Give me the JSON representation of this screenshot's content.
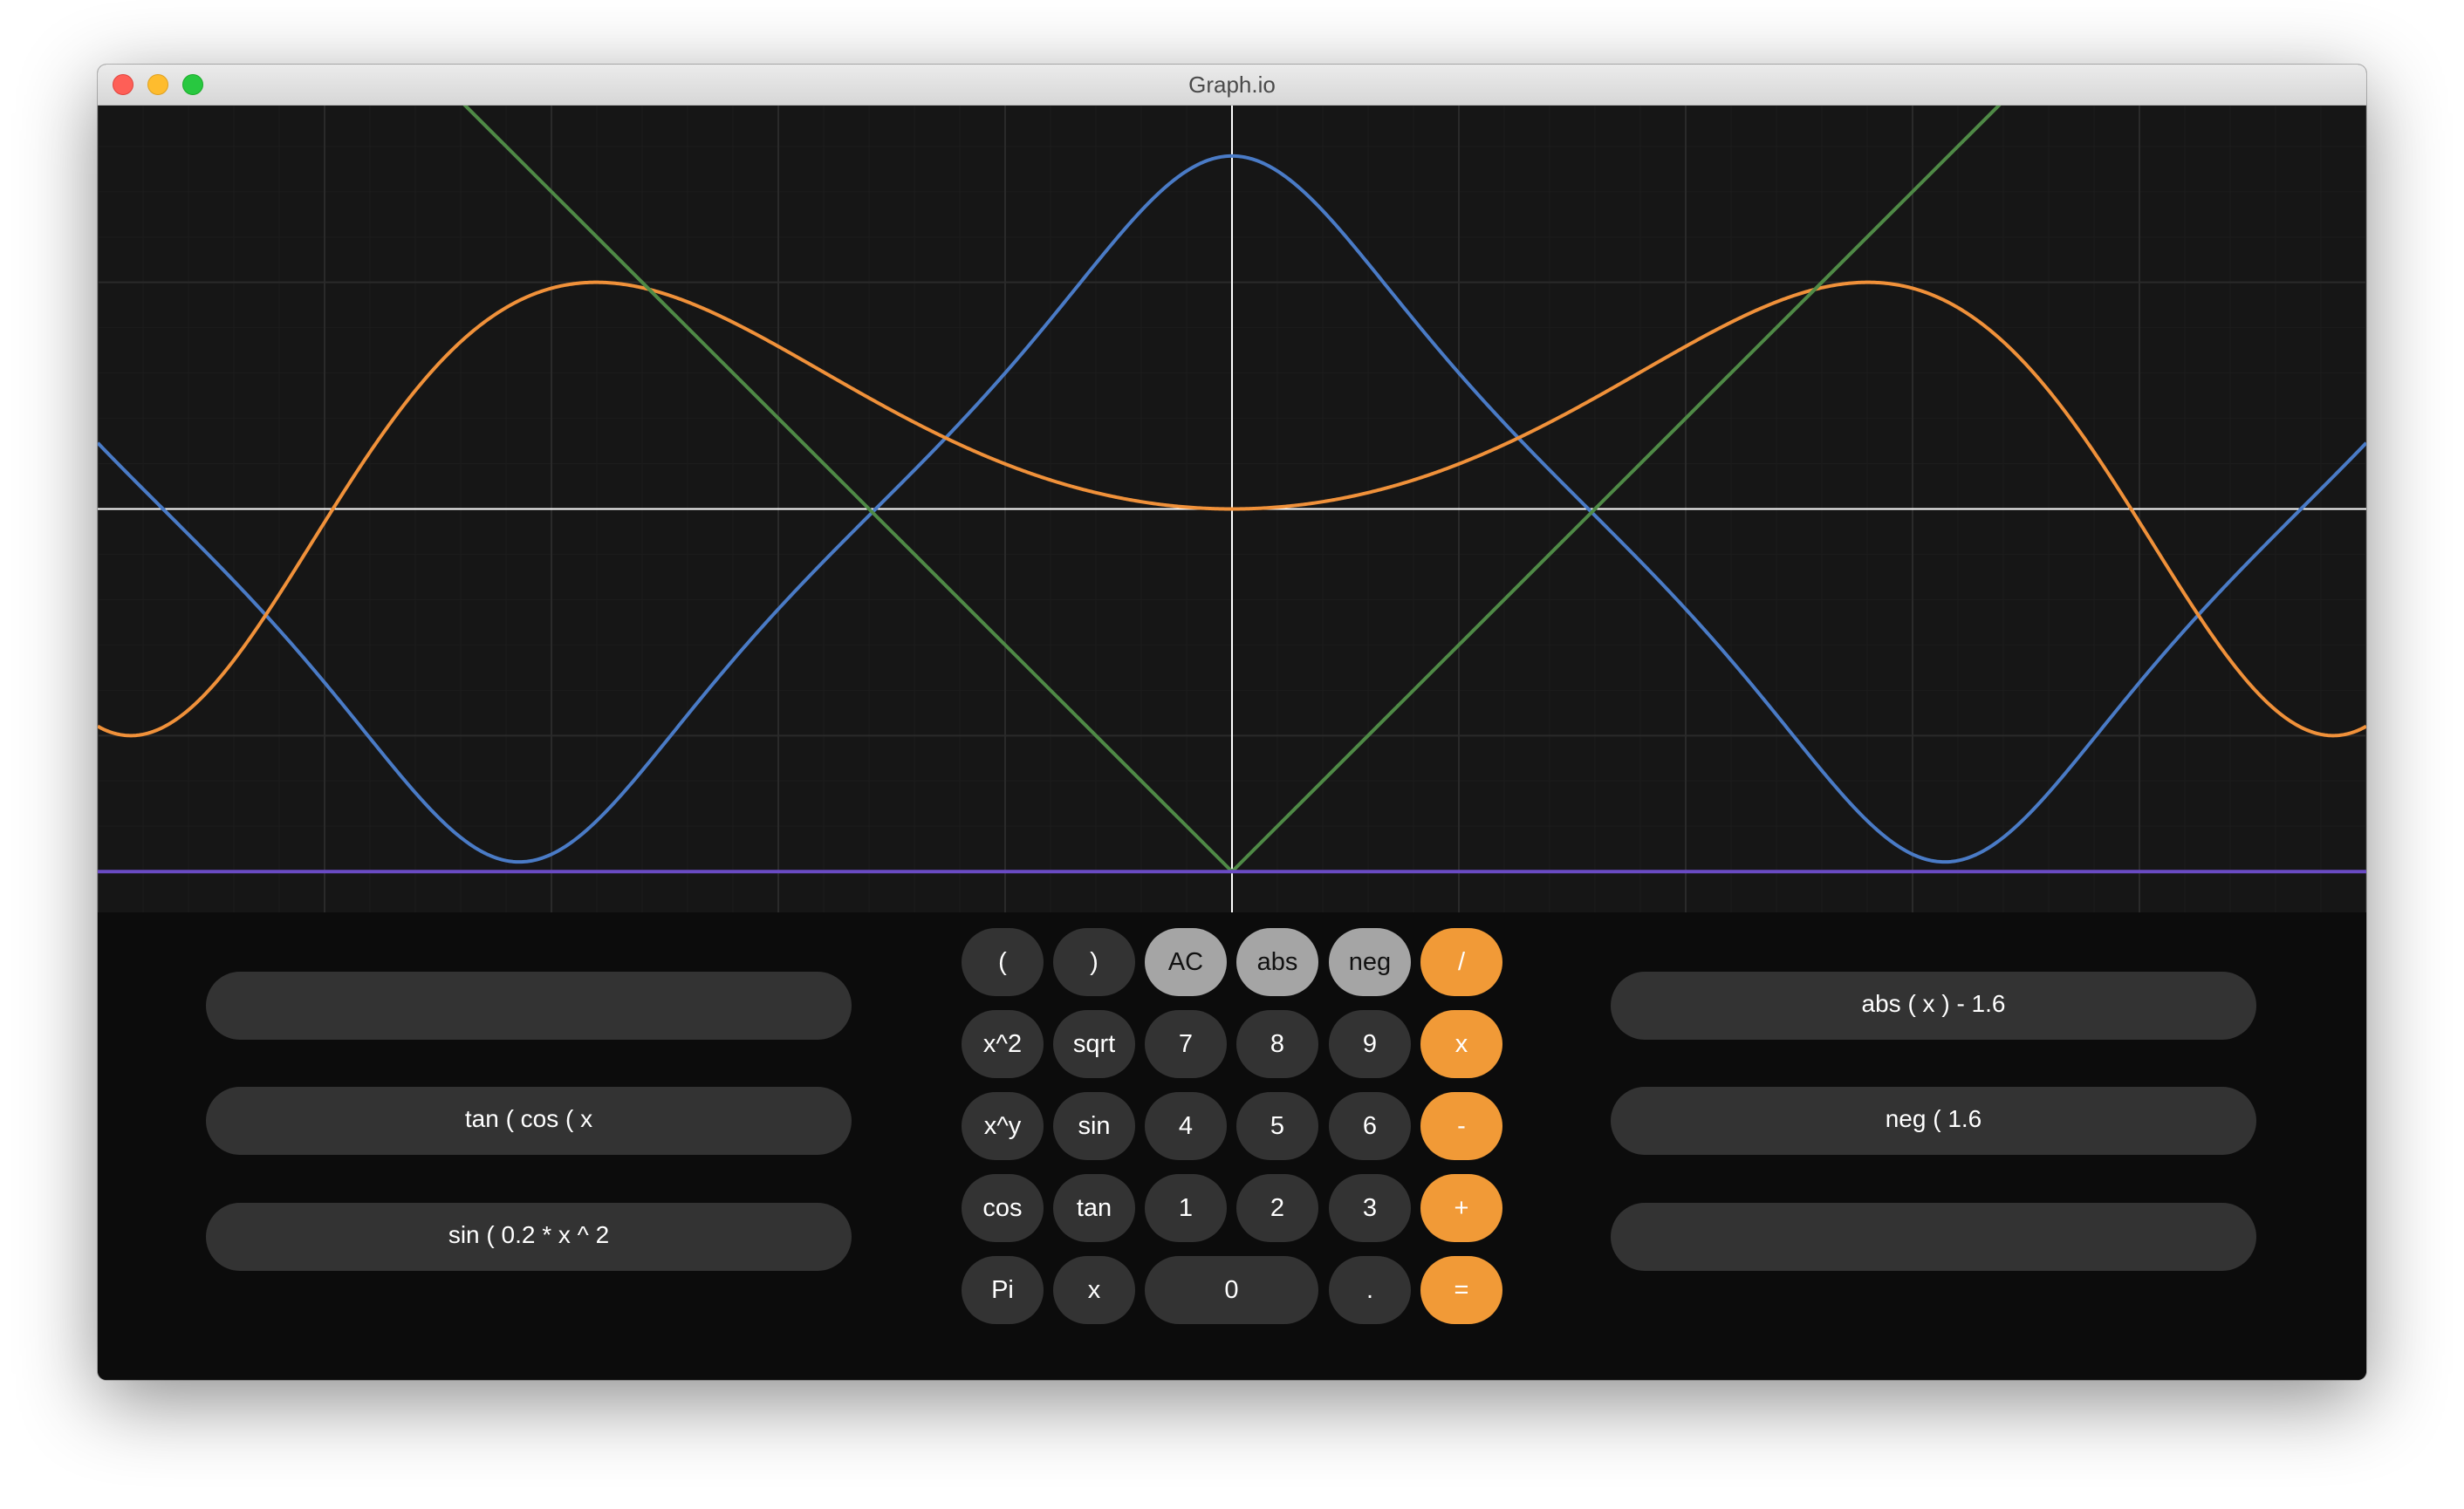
{
  "window": {
    "title": "Graph.io"
  },
  "colors": {
    "background": "#161616",
    "axis": "#ffffff",
    "grid": "#2a2a2a",
    "series_blue": "#4a7bc6",
    "series_orange": "#f0913a",
    "series_green": "#4f8a46",
    "series_purple": "#6a4bc4"
  },
  "graph": {
    "x_range": [
      -5,
      5
    ],
    "y_range": [
      -1.78,
      1.78
    ],
    "grid_step_x": 1,
    "grid_step_y": 1
  },
  "chart_data": {
    "type": "line",
    "x_range": [
      -5,
      5
    ],
    "y_range": [
      -1.78,
      1.78
    ],
    "grid": true,
    "series": [
      {
        "expr": "tan ( cos ( x",
        "color": "#4a7bc6"
      },
      {
        "expr": "sin ( 0.2 * x ^ 2",
        "color": "#f0913a"
      },
      {
        "expr": "abs ( x ) - 1.6",
        "color": "#4f8a46"
      },
      {
        "expr": "neg ( 1.6",
        "color": "#6a4bc4"
      }
    ]
  },
  "left_fields": [
    "",
    "tan ( cos ( x",
    "sin ( 0.2 * x ^ 2"
  ],
  "right_fields": [
    "abs ( x ) - 1.6",
    "neg ( 1.6",
    ""
  ],
  "keypad": {
    "open_paren": "(",
    "close_paren": ")",
    "ac": "AC",
    "abs": "abs",
    "neg": "neg",
    "divide": "/",
    "square": "x^2",
    "sqrt": "sqrt",
    "seven": "7",
    "eight": "8",
    "nine": "9",
    "multiply": "x",
    "power": "x^y",
    "sin": "sin",
    "four": "4",
    "five": "5",
    "six": "6",
    "minus": "-",
    "cos": "cos",
    "tan": "tan",
    "one": "1",
    "two": "2",
    "three": "3",
    "plus": "+",
    "pi": "Pi",
    "variable_x": "x",
    "zero": "0",
    "decimal": ".",
    "equals": "="
  }
}
